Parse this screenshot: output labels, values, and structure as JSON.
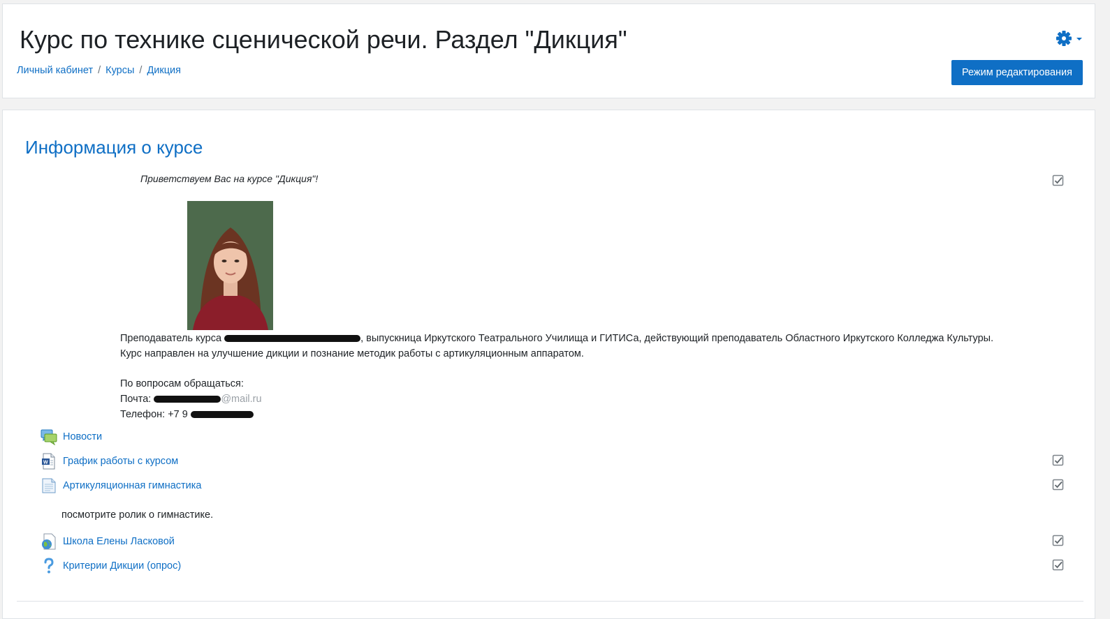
{
  "header": {
    "title": "Курс по технике сценической речи. Раздел \"Дикция\"",
    "breadcrumb": [
      "Личный кабинет",
      "Курсы",
      "Дикция"
    ],
    "breadcrumb_separator": "/",
    "settings_icon": "gear-icon",
    "edit_button_label": "Режим редактирования"
  },
  "section": {
    "title": "Информация о курсе",
    "welcome": "Приветствуем Вас на  курсе \"Дикция\"!",
    "teacher_prefix": "Преподаватель курса",
    "teacher_suffix": ", выпускница Иркутского Театрального Училища и ГИТИСа, действующий преподаватель Областного Иркутского Колледжа Культуры.",
    "course_goal": "Курс направлен на улучшение дикции и познание методик работы с артикуляционным аппаратом.",
    "contact_heading": " По вопросам обращаться:",
    "email_label": "Почта:",
    "email_domain": "@mail.ru",
    "phone_label": "Телефон: +7",
    "phone_fragment": "9"
  },
  "activities": [
    {
      "name": "Новости",
      "icon": "forum-icon"
    },
    {
      "name": "График работы с курсом",
      "icon": "word-document-icon"
    },
    {
      "name": "Артикуляционная гимнастика",
      "icon": "page-icon"
    },
    {
      "name": "Школа Елены Ласковой",
      "icon": "url-link-icon"
    },
    {
      "name": "Критерии Дикции (опрос)",
      "icon": "questionnaire-icon"
    }
  ],
  "activity_note": "посмотрите ролик о гимнастике.",
  "colors": {
    "accent": "#0f6fc5",
    "text": "#1d2125",
    "background": "#f2f2f2"
  }
}
